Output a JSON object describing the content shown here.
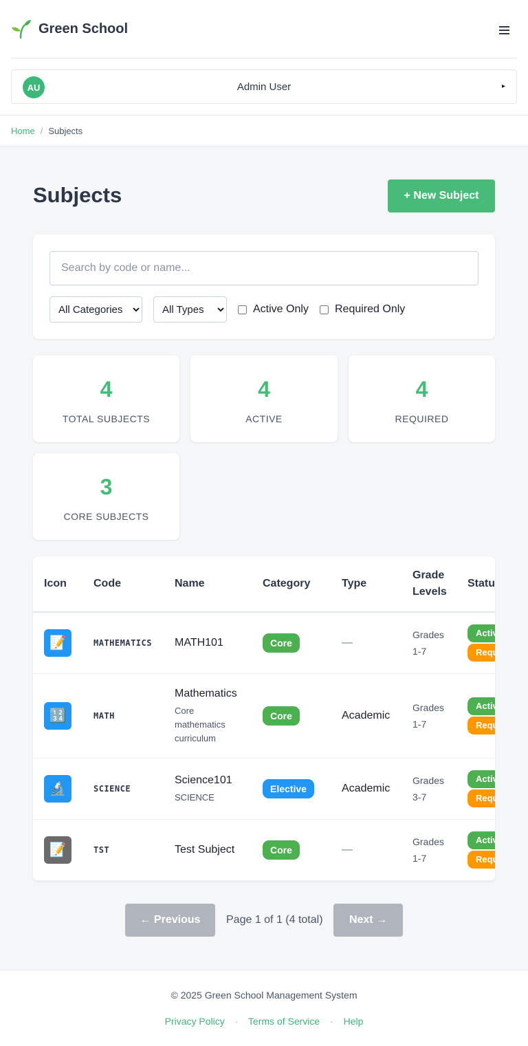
{
  "brand": {
    "name": "Green School"
  },
  "user": {
    "initials": "AU",
    "name": "Admin User",
    "caret": "▸"
  },
  "breadcrumb": {
    "home": "Home",
    "separator": "/",
    "current": "Subjects"
  },
  "page": {
    "title": "Subjects",
    "new_button": "+ New Subject"
  },
  "filters": {
    "search_placeholder": "Search by code or name...",
    "category_selected": "All Categories",
    "type_selected": "All Types",
    "active_only_label": "Active Only",
    "required_only_label": "Required Only"
  },
  "stats": [
    {
      "value": "4",
      "label": "TOTAL SUBJECTS"
    },
    {
      "value": "4",
      "label": "ACTIVE"
    },
    {
      "value": "4",
      "label": "REQUIRED"
    },
    {
      "value": "3",
      "label": "CORE SUBJECTS"
    }
  ],
  "table": {
    "headers": {
      "icon": "Icon",
      "code": "Code",
      "name": "Name",
      "category": "Category",
      "type": "Type",
      "grade": "Grade Levels",
      "status": "Status"
    },
    "rows": [
      {
        "icon": "📝",
        "icon_name": "memo-icon",
        "icon_color": "#2196f3",
        "code": "MATHEMATICS",
        "name": "MATH101",
        "subtitle": "",
        "category": "Core",
        "type": "—",
        "grades": "Grades 1-7",
        "status_active": "Active",
        "status_required": "Required"
      },
      {
        "icon": "🔢",
        "icon_name": "numbers-icon",
        "icon_color": "#2196f3",
        "code": "MATH",
        "name": "Mathematics",
        "subtitle": "Core mathematics curriculum",
        "category": "Core",
        "type": "Academic",
        "grades": "Grades 1-7",
        "status_active": "Active",
        "status_required": "Required"
      },
      {
        "icon": "🔬",
        "icon_name": "microscope-icon",
        "icon_color": "#2196f3",
        "code": "SCIENCE",
        "name": "Science101",
        "subtitle": "SCIENCE",
        "category": "Elective",
        "type": "Academic",
        "grades": "Grades 3-7",
        "status_active": "Active",
        "status_required": "Required"
      },
      {
        "icon": "📝",
        "icon_name": "memo-icon",
        "icon_color": "#6b6b6b",
        "code": "TST",
        "name": "Test Subject",
        "subtitle": "",
        "category": "Core",
        "type": "—",
        "grades": "Grades 1-7",
        "status_active": "Active",
        "status_required": "Required"
      }
    ]
  },
  "pagination": {
    "prev": "← Previous",
    "info": "Page 1 of 1 (4 total)",
    "next": "Next →"
  },
  "footer": {
    "copyright": "© 2025 Green School Management System",
    "links": [
      "Privacy Policy",
      "Terms of Service",
      "Help"
    ],
    "separator": "·"
  },
  "colors": {
    "accent": "#48bb78",
    "core_badge": "#4caf50",
    "elective_badge": "#2196f3",
    "required_badge": "#ff9800"
  }
}
